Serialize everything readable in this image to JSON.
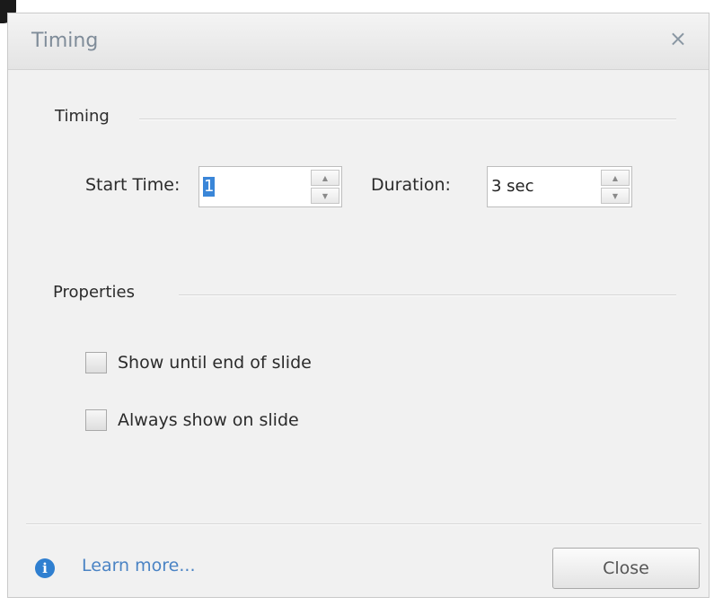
{
  "dialog": {
    "title": "Timing",
    "close_icon": "×"
  },
  "timing_section": {
    "label": "Timing",
    "start_time": {
      "label": "Start Time:",
      "value": "1"
    },
    "duration": {
      "label": "Duration:",
      "value": "3 sec"
    }
  },
  "properties_section": {
    "label": "Properties",
    "options": [
      {
        "label": "Show until end of slide",
        "checked": false
      },
      {
        "label": "Always show on slide",
        "checked": false
      }
    ]
  },
  "footer": {
    "info_icon": "i",
    "learn_more": "Learn more...",
    "close_label": "Close"
  },
  "icons": {
    "spin_up": "▲",
    "spin_down": "▼",
    "close": "close-icon",
    "info": "info-icon"
  },
  "colors": {
    "title_text": "#7f8c99",
    "link": "#4a83c4",
    "info_icon": "#2f7fd0",
    "selection": "#3a86d8"
  }
}
